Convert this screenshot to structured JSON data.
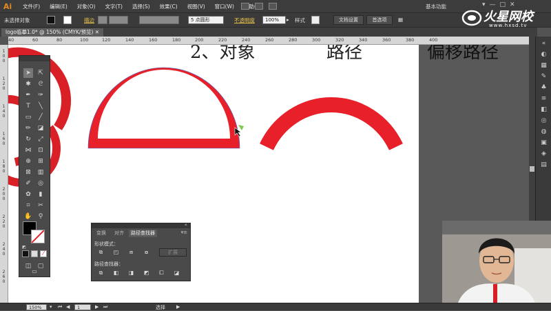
{
  "app": {
    "logo": "Ai"
  },
  "menubar": {
    "items": [
      "文件(F)",
      "编辑(E)",
      "对象(O)",
      "文字(T)",
      "选择(S)",
      "效果(C)",
      "视图(V)",
      "窗口(W)",
      "帮助(H)"
    ],
    "workspace": "基本功能",
    "window_controls": [
      "▾",
      "—",
      "□",
      "✕"
    ]
  },
  "controlbar": {
    "selection": "未选择对象",
    "stroke_label": "描边",
    "stroke_weight_unit": "5 点圆形",
    "opacity_label": "不透明度",
    "opacity_value": "100%",
    "style_label": "样式",
    "doc_setup": "文档设置",
    "preferences": "首选项"
  },
  "tab": {
    "title": "logo临摹1.0* @ 150% (CMYK/预览)"
  },
  "ruler_top": [
    "40",
    "60",
    "80",
    "100",
    "120",
    "140",
    "160",
    "180",
    "200",
    "220",
    "240",
    "260",
    "280",
    "300",
    "320",
    "340",
    "360",
    "380",
    "400"
  ],
  "ruler_left": [
    "1 0 0",
    "1 2 0",
    "1 4 0",
    "1 6 0",
    "1 8 0",
    "2 0 0",
    "2 2 0",
    "2 4 0",
    "2 6 0"
  ],
  "canvas": {
    "text_left": "2、对象",
    "text_mid": "路径",
    "text_right": "偏移路径"
  },
  "colors": {
    "accent_red": "#e8202a",
    "path_outline": "#3a6bd1"
  },
  "pathfinder": {
    "tabs": [
      "变换",
      "对齐",
      "路径查找器"
    ],
    "shape_modes_label": "形状模式：",
    "expand_label": "扩展",
    "pathfinders_label": "路径查找器："
  },
  "statusbar": {
    "zoom": "150%",
    "page": "1",
    "tool": "选择"
  },
  "watermark": {
    "title": "火星网校",
    "url": "www.hxsd.tv"
  }
}
